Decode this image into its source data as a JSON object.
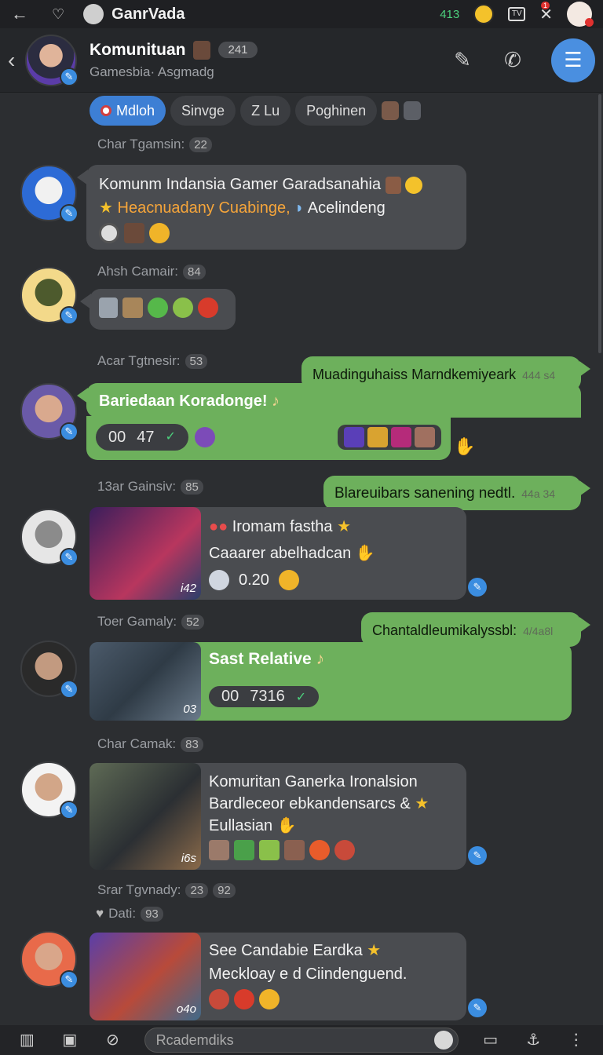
{
  "status_bar": {
    "title": "GanrVada",
    "count": "413",
    "badge": "1"
  },
  "header": {
    "title": "Komunituan",
    "member_count": "241",
    "subtitle": "Gamesbia· Asgmadg",
    "icons": [
      "back-icon",
      "edit-icon",
      "phone-icon",
      "menu-icon"
    ]
  },
  "chips": [
    {
      "label": "Mdloh",
      "active": true
    },
    {
      "label": "Sinvge",
      "active": false
    },
    {
      "label": "Z Lu",
      "active": false
    },
    {
      "label": "Poghinen",
      "active": false
    }
  ],
  "messages": [
    {
      "sender": "Char Tgamsin:",
      "num": "22",
      "line1": "Komunm Indansia Gamer Garadsanahia",
      "line2a": "Heacnuadany Cuabinge,",
      "line2b": "Acelindeng"
    },
    {
      "sender": "Ahsh Camair:",
      "num": "84"
    },
    {
      "sender": "Acar Tgtnesir:",
      "num": "53",
      "outgoing_text": "Muadinguhaiss Marndkemiyeark",
      "outgoing_time": "444 s4",
      "title": "Bariedaan Koradonge!",
      "pill_a": "00",
      "pill_b": "47"
    },
    {
      "sender": "13ar Gainsiv:",
      "num": "85",
      "outgoing_text": "Blareuibars sanening nedtl.",
      "outgoing_time": "44a 34",
      "line1": "Iromam fastha",
      "line2": "Caaarer abelhadcan",
      "value": "0.20",
      "thumb_tag": "i42"
    },
    {
      "sender": "Toer Gamaly:",
      "num": "52",
      "outgoing_text": "Chantaldleumikalyssbl:",
      "outgoing_time": "4/4a8l",
      "title": "Sast Relative",
      "pill_a": "00",
      "pill_b": "7316",
      "thumb_tag": "03"
    },
    {
      "sender": "Char Camak:",
      "num": "83",
      "line1": "Komuritan Ganerka Ironalsion",
      "line2": "Bardleceor ebkandensarcs &",
      "line3": "Eullasian",
      "thumb_tag": "i6s"
    },
    {
      "sender": "Srar Tgvnady:",
      "num": "23",
      "num2": "92",
      "sub_label": "Dati:",
      "sub_num": "93",
      "line1": "See Candabie Eardka",
      "line2": "Meckloay e d Ciindenguend.",
      "thumb_tag": "o4o"
    }
  ],
  "composer": {
    "placeholder": "Rcademdiks"
  },
  "colors": {
    "accent_blue": "#3d7fd4",
    "bubble_green": "#6db05c",
    "bubble_gray": "#4a4c50",
    "orange_text": "#f6a53a"
  }
}
